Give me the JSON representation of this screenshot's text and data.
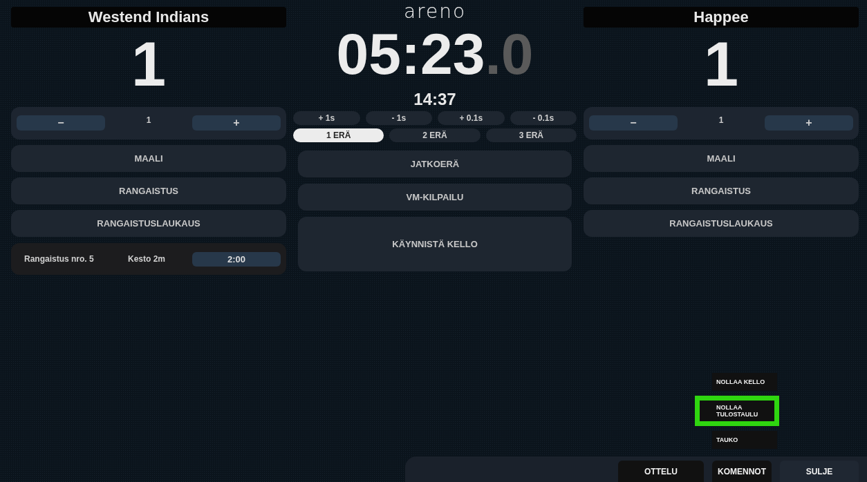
{
  "logo": "areno",
  "clock": {
    "main": "05:23",
    "fraction": ".0"
  },
  "time_of_day": "14:37",
  "adjust_buttons": [
    "+ 1s",
    "- 1s",
    "+ 0.1s",
    "- 0.1s"
  ],
  "periods": [
    {
      "label": "1 ERÄ",
      "selected": true
    },
    {
      "label": "2 ERÄ",
      "selected": false
    },
    {
      "label": "3 ERÄ",
      "selected": false
    }
  ],
  "center_buttons": [
    {
      "label": "JATKOERÄ",
      "kind": "normal"
    },
    {
      "label": "VM-KILPAILU",
      "kind": "normal"
    },
    {
      "label": "KÄYNNISTÄ KELLO",
      "kind": "large"
    }
  ],
  "teams": [
    {
      "name": "Westend Indians",
      "score": "1",
      "counter": {
        "minus": "−",
        "value": "1",
        "plus": "+"
      },
      "actions": [
        "MAALI",
        "RANGAISTUS",
        "RANGAISTUSLAUKAUS"
      ],
      "penalties": [
        {
          "title": "Rangaistus nro. 5",
          "duration": "Kesto 2m",
          "time": "2:00"
        }
      ]
    },
    {
      "name": "Happee",
      "score": "1",
      "counter": {
        "minus": "−",
        "value": "1",
        "plus": "+"
      },
      "actions": [
        "MAALI",
        "RANGAISTUS",
        "RANGAISTUSLAUKAUS"
      ]
    }
  ],
  "commands_menu": [
    {
      "label": "NOLLAA KELLO",
      "highlighted": false
    },
    {
      "label": "NOLLAA TULOSTAULU",
      "highlighted": true
    },
    {
      "label": "TAUKO",
      "highlighted": false
    }
  ],
  "bottom_buttons": [
    {
      "label": "OTTELU",
      "kind": "dark"
    },
    {
      "label": "KOMENNOT",
      "kind": "dark"
    },
    {
      "label": "SULJE",
      "kind": "light"
    }
  ]
}
